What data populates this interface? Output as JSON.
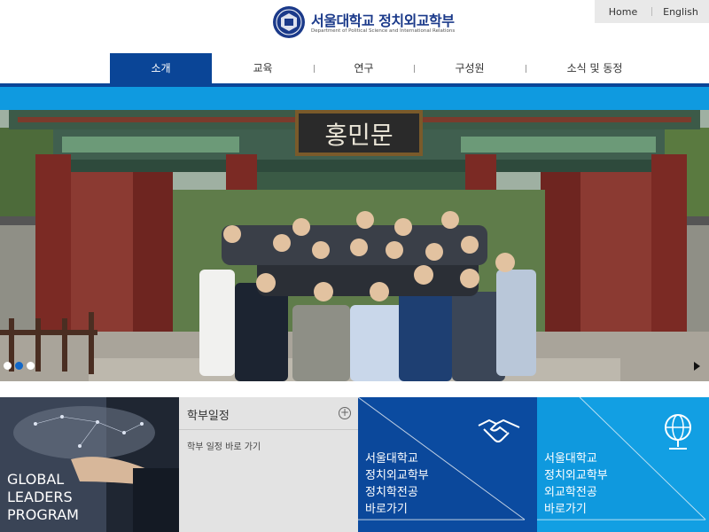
{
  "header": {
    "logo_title": "서울대학교 정치외교학부",
    "logo_subtitle": "Department of Political Science and International Relations"
  },
  "util_links": [
    {
      "label": "Home"
    },
    {
      "label": "English"
    }
  ],
  "nav": {
    "items": [
      {
        "label": "소개",
        "active": true
      },
      {
        "label": "교육"
      },
      {
        "label": "연구"
      },
      {
        "label": "구성원"
      },
      {
        "label": "소식 및 동정"
      }
    ]
  },
  "hero": {
    "gate_sign": "홍민문",
    "slider": {
      "count": 3,
      "active_index": 1
    }
  },
  "tiles": {
    "global": {
      "lines": [
        "GLOBAL",
        "LEADERS",
        "PROGRAM"
      ]
    },
    "schedule": {
      "title": "학부일정",
      "link": "학부 일정 바로 가기"
    },
    "political_science": {
      "lines": [
        "서울대학교",
        "정치외교학부",
        "정치학전공",
        "바로가기"
      ],
      "icon": "handshake-icon"
    },
    "international_relations": {
      "lines": [
        "서울대학교",
        "정치외교학부",
        "외교학전공",
        "바로가기"
      ],
      "icon": "globe-icon"
    }
  },
  "colors": {
    "primary_blue": "#0a4597",
    "light_blue": "#0f9ae0",
    "tile_light_blue": "#129fe3"
  }
}
